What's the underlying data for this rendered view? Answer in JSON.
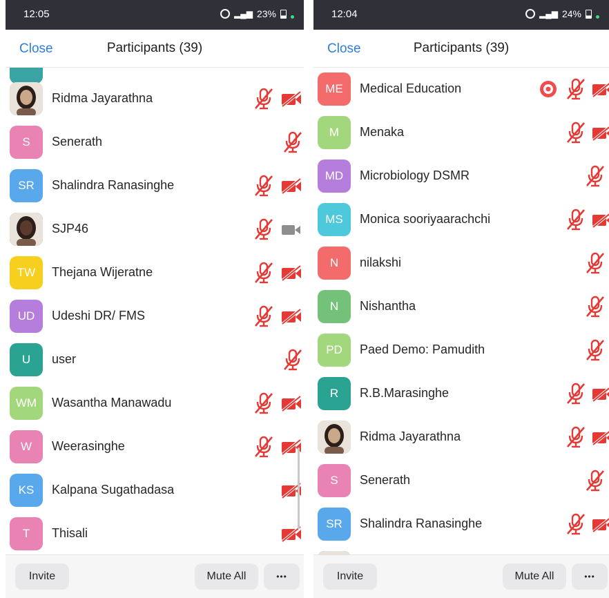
{
  "colors": {
    "status_bar": "#2f3038",
    "accent_blue": "#2d7ee0",
    "muted_red": "#e53935",
    "video_gray": "#8e8e8e",
    "record_red": "#ef4d4d"
  },
  "screens": [
    {
      "status_bar": {
        "time": "12:05",
        "indicators": "23%"
      },
      "header": {
        "close_label": "Close",
        "title": "Participants (39)"
      },
      "participants": [
        {
          "initials": "",
          "name": "",
          "color": "#3aa3a3",
          "photo": false,
          "mic": "none",
          "video": "none",
          "partial": true
        },
        {
          "initials": "",
          "name": "Ridma Jayarathna",
          "color": "#c9a98a",
          "photo": true,
          "mic": "muted",
          "video": "off"
        },
        {
          "initials": "S",
          "name": "Senerath",
          "color": "#e883b3",
          "photo": false,
          "mic": "muted",
          "video": "none"
        },
        {
          "initials": "SR",
          "name": "Shalindra Ranasinghe",
          "color": "#5aa8ec",
          "photo": false,
          "mic": "muted",
          "video": "off"
        },
        {
          "initials": "",
          "name": "SJP46",
          "color": "#5b3a2e",
          "photo": true,
          "mic": "muted",
          "video": "available"
        },
        {
          "initials": "TW",
          "name": "Thejana Wijeratne",
          "color": "#f6cf1f",
          "photo": false,
          "mic": "muted",
          "video": "off"
        },
        {
          "initials": "UD",
          "name": "Udeshi DR/ FMS",
          "color": "#b57edc",
          "photo": false,
          "mic": "muted",
          "video": "off"
        },
        {
          "initials": "U",
          "name": "user",
          "color": "#2aa392",
          "photo": false,
          "mic": "muted",
          "video": "none"
        },
        {
          "initials": "WM",
          "name": "Wasantha Manawadu",
          "color": "#a3d77e",
          "photo": false,
          "mic": "muted",
          "video": "off"
        },
        {
          "initials": "W",
          "name": "Weerasinghe",
          "color": "#e883b3",
          "photo": false,
          "mic": "muted",
          "video": "off"
        },
        {
          "initials": "KS",
          "name": "Kalpana Sugathadasa",
          "color": "#5aa8ec",
          "photo": false,
          "mic": "none",
          "video": "off"
        },
        {
          "initials": "T",
          "name": "Thisali",
          "color": "#e883b3",
          "photo": false,
          "mic": "none",
          "video": "off"
        }
      ],
      "footer": {
        "invite_label": "Invite",
        "mute_all_label": "Mute All",
        "more_label": "•••"
      }
    },
    {
      "status_bar": {
        "time": "12:04",
        "indicators": "24%"
      },
      "header": {
        "close_label": "Close",
        "title": "Participants (39)"
      },
      "participants": [
        {
          "initials": "ME",
          "name": "Medical Education",
          "color": "#f36b6b",
          "photo": false,
          "mic": "muted",
          "video": "off",
          "recording": true
        },
        {
          "initials": "M",
          "name": "Menaka",
          "color": "#a3d77e",
          "photo": false,
          "mic": "muted",
          "video": "off"
        },
        {
          "initials": "MD",
          "name": "Microbiology DSMR",
          "color": "#b57edc",
          "photo": false,
          "mic": "muted",
          "video": "none"
        },
        {
          "initials": "MS",
          "name": "Monica sooriyaarachchi",
          "color": "#4ec9dc",
          "photo": false,
          "mic": "muted",
          "video": "off"
        },
        {
          "initials": "N",
          "name": "nilakshi",
          "color": "#f36b6b",
          "photo": false,
          "mic": "muted",
          "video": "none"
        },
        {
          "initials": "N",
          "name": "Nishantha",
          "color": "#74c27a",
          "photo": false,
          "mic": "muted",
          "video": "none"
        },
        {
          "initials": "PD",
          "name": "Paed Demo: Pamudith",
          "color": "#a3d77e",
          "photo": false,
          "mic": "muted",
          "video": "none"
        },
        {
          "initials": "R",
          "name": "R.B.Marasinghe",
          "color": "#2aa392",
          "photo": false,
          "mic": "muted",
          "video": "off"
        },
        {
          "initials": "",
          "name": "Ridma Jayarathna",
          "color": "#c9a98a",
          "photo": true,
          "mic": "muted",
          "video": "off"
        },
        {
          "initials": "S",
          "name": "Senerath",
          "color": "#e883b3",
          "photo": false,
          "mic": "muted",
          "video": "none"
        },
        {
          "initials": "SR",
          "name": "Shalindra Ranasinghe",
          "color": "#5aa8ec",
          "photo": false,
          "mic": "muted",
          "video": "off"
        },
        {
          "initials": "",
          "name": "",
          "color": "#3b2a22",
          "photo": true,
          "mic": "none",
          "video": "none",
          "partial": true
        }
      ],
      "footer": {
        "invite_label": "Invite",
        "mute_all_label": "Mute All",
        "more_label": "•••"
      }
    }
  ]
}
